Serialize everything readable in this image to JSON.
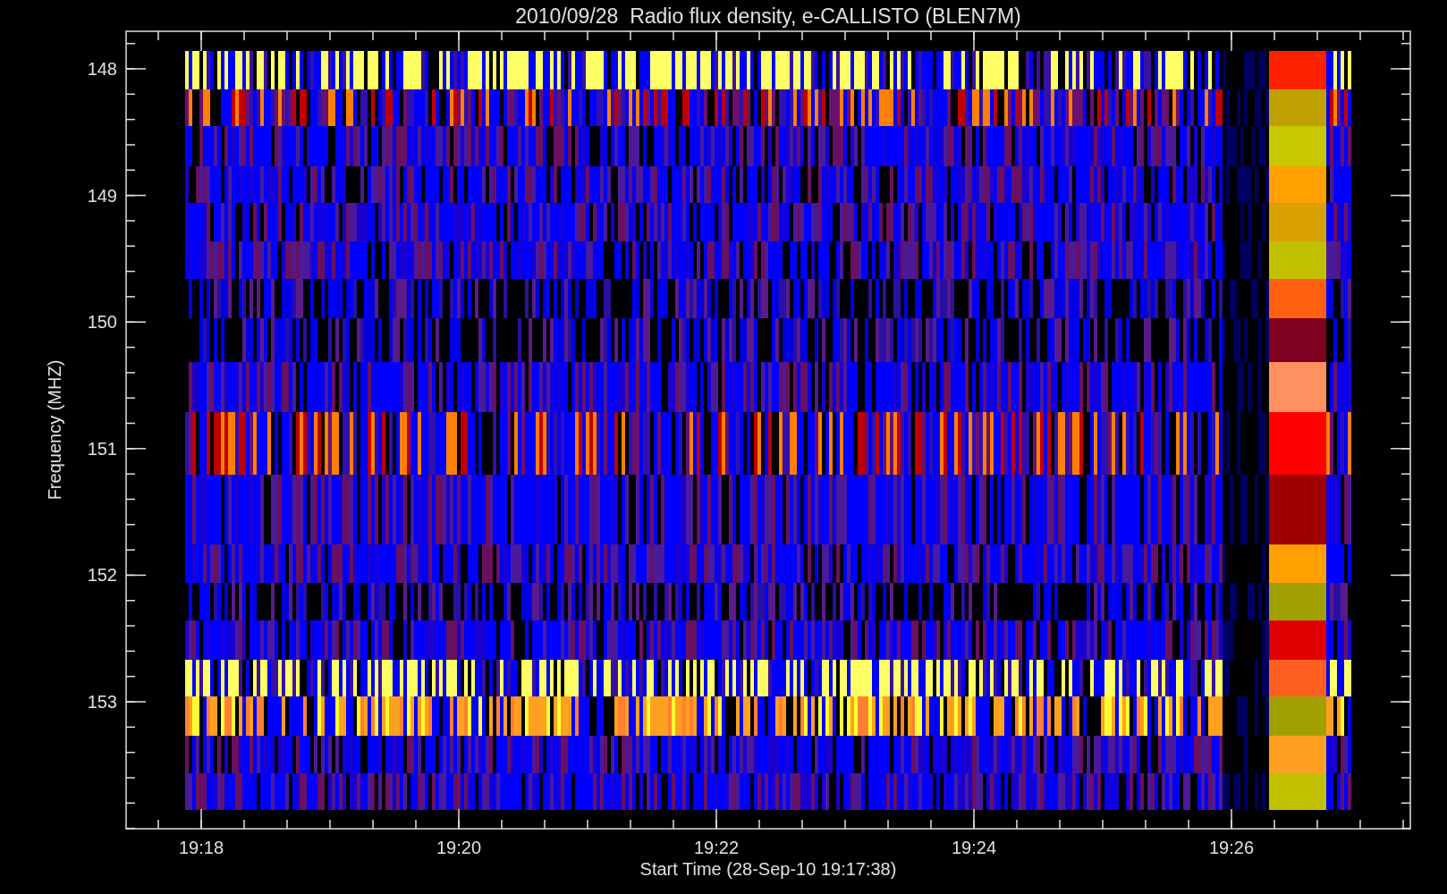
{
  "title": "2010/09/28  Radio flux density, e-CALLISTO (BLEN7M)",
  "ylabel": "Frequency (MHZ)",
  "yticks": [
    "148",
    "149",
    "150",
    "151",
    "152",
    "153"
  ],
  "xlabel": "Start Time (28-Sep-10 19:17:38)",
  "xticks": [
    "19:18",
    "19:20",
    "19:22",
    "19:24",
    "19:26"
  ]
}
